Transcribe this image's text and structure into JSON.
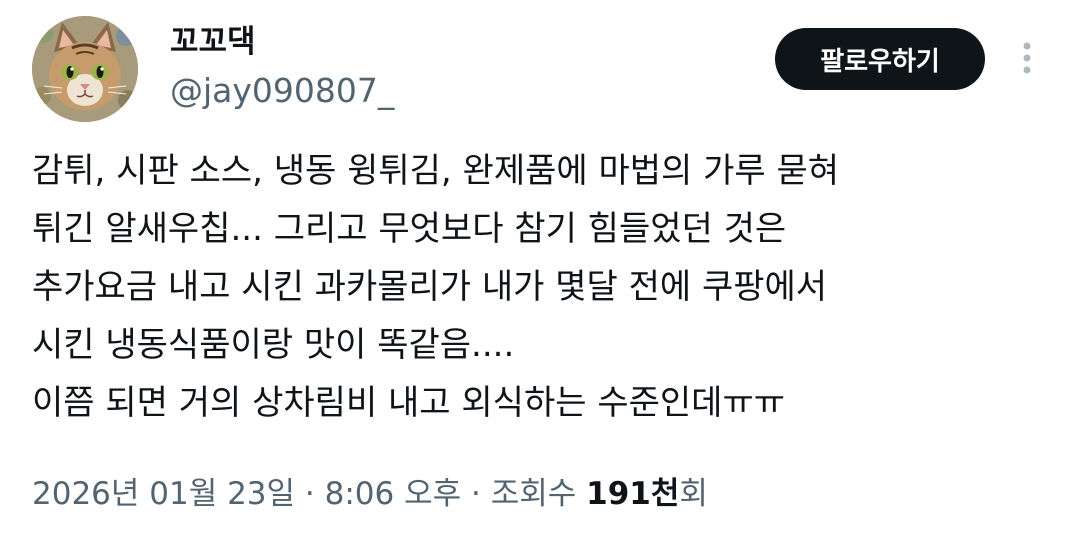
{
  "user": {
    "display_name": "꼬꼬댁",
    "handle": "@jay090807_",
    "avatar_icon": "cat-face-avatar"
  },
  "actions": {
    "follow_label": "팔로우하기",
    "more_icon": "more-vertical-icon"
  },
  "tweet": {
    "lines": [
      "감튀, 시판 소스, 냉동 윙튀김, 완제품에 마법의 가루 묻혀",
      "튀긴 알새우칩... 그리고 무엇보다 참기 힘들었던 것은",
      "추가요금 내고 시킨 과카몰리가 내가 몇달 전에 쿠팡에서",
      "시킨 냉동식품이랑 맛이 똑같음....",
      "이쯤 되면 거의 상차림비 내고 외식하는 수준인데ㅠㅠ"
    ]
  },
  "meta": {
    "date": "2026년 01월 23일",
    "separator": " · ",
    "time": "8:06 오후",
    "views_prefix": "조회수 ",
    "views_count": "191천",
    "views_suffix": "회"
  },
  "colors": {
    "text_primary": "#0f1419",
    "text_secondary": "#536471",
    "follow_bg": "#0f1419",
    "follow_text": "#ffffff",
    "more_dots": "#b0b8bf"
  }
}
